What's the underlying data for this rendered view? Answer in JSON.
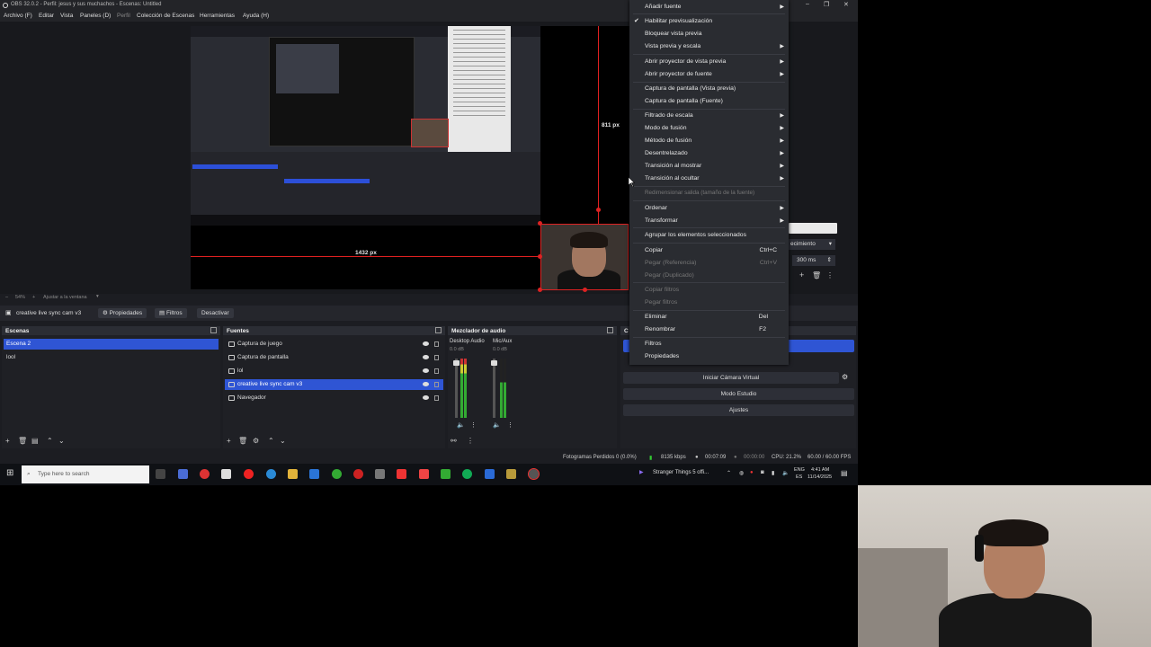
{
  "window": {
    "title": "OBS 32.0.2 - Perfil: jesus y sus muchachos - Escenas: Untitled",
    "controls": [
      "–",
      "❐",
      "✕"
    ]
  },
  "menu": [
    "Archivo (F)",
    "Editar",
    "Vista",
    "Paneles (D)",
    "Perfil",
    "Colección de Escenas",
    "Herramientas",
    "Ayuda (H)"
  ],
  "preview": {
    "dim_horizontal": "1432 px",
    "dim_vertical": "811 px",
    "zoom": "54%",
    "fit": "Ajustar a la ventana"
  },
  "source_toolbar": {
    "selected": "creative live sync cam v3",
    "properties": "Propiedades",
    "filters": "Filtros",
    "deactivate": "Desactivar"
  },
  "scenes": {
    "title": "Escenas",
    "items": [
      "Escena 2",
      "lool"
    ]
  },
  "sources": {
    "title": "Fuentes",
    "items": [
      "Captura de juego",
      "Captura de pantalla",
      "lol",
      "creative live sync cam v3",
      "Navegador"
    ]
  },
  "mixer": {
    "title": "Mezclador de audio",
    "channels": [
      {
        "name": "Desktop Audio",
        "db": "0.0 dB"
      },
      {
        "name": "Mic/Aux",
        "db": "0.0 dB"
      }
    ]
  },
  "transitions": {
    "partial": "ecimiento",
    "duration": "300 ms"
  },
  "controls": {
    "virtual_cam": "Iniciar Cámara Virtual",
    "studio": "Modo Estudio",
    "settings": "Ajustes"
  },
  "status": {
    "dropped": "Fotogramas Perdidos 0 (0.0%)",
    "bitrate": "8135 kbps",
    "rec": "00:07:09",
    "stream": "00:00:00",
    "cpu": "CPU: 21.2%",
    "fps": "60.00 / 60.00 FPS"
  },
  "taskbar": {
    "search_placeholder": "Type here to search",
    "media": "Stranger Things 5 offi...",
    "lang": "ENG",
    "region": "ES",
    "time": "4:41 AM",
    "date": "11/14/2025"
  },
  "context_menu": {
    "items": [
      {
        "label": "Añadir fuente",
        "arrow": true
      },
      {
        "label": "Habilitar previsualización",
        "check": true
      },
      {
        "label": "Bloquear vista previa"
      },
      {
        "label": "Vista previa y escala",
        "arrow": true
      },
      {
        "label": "Abrir proyector de vista previa",
        "arrow": true
      },
      {
        "label": "Abrir proyector de fuente",
        "arrow": true
      },
      {
        "label": "Captura de pantalla (Vista previa)"
      },
      {
        "label": "Captura de pantalla (Fuente)"
      },
      {
        "label": "Filtrado de escala",
        "arrow": true
      },
      {
        "label": "Modo de fusión",
        "arrow": true
      },
      {
        "label": "Método de fusión",
        "arrow": true
      },
      {
        "label": "Desentrelazado",
        "arrow": true
      },
      {
        "label": "Transición al mostrar",
        "arrow": true
      },
      {
        "label": "Transición al ocultar",
        "arrow": true
      },
      {
        "label": "Redimensionar salida (tamaño de la fuente)",
        "disabled": true
      },
      {
        "label": "Ordenar",
        "arrow": true
      },
      {
        "label": "Transformar",
        "arrow": true
      },
      {
        "label": "Agrupar los elementos seleccionados"
      },
      {
        "label": "Copiar",
        "shortcut": "Ctrl+C"
      },
      {
        "label": "Pegar (Referencia)",
        "shortcut": "Ctrl+V",
        "disabled": true
      },
      {
        "label": "Pegar (Duplicado)",
        "disabled": true
      },
      {
        "label": "Copiar filtros",
        "disabled": true
      },
      {
        "label": "Pegar filtros",
        "disabled": true
      },
      {
        "label": "Eliminar",
        "shortcut": "Del"
      },
      {
        "label": "Renombrar",
        "shortcut": "F2"
      },
      {
        "label": "Filtros"
      },
      {
        "label": "Propiedades"
      }
    ]
  }
}
